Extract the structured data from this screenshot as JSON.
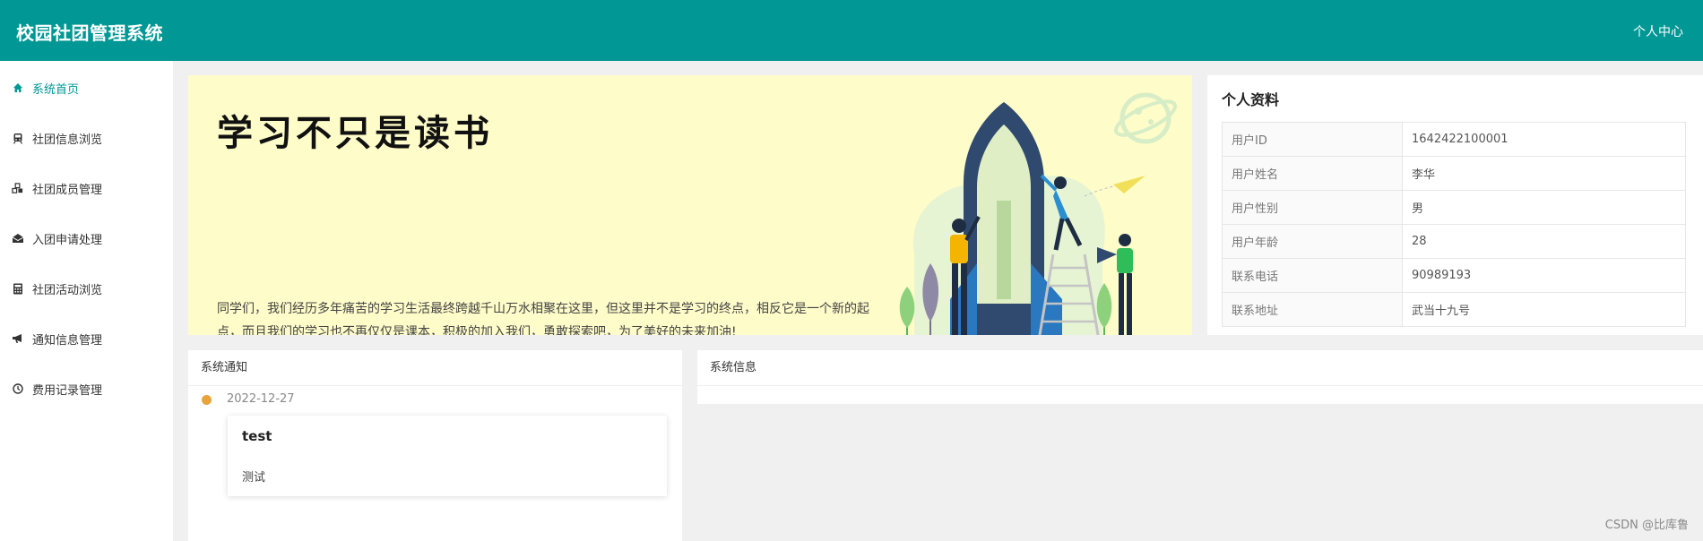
{
  "header": {
    "app_title": "校园社团管理系统",
    "user_center": "个人中心"
  },
  "sidebar": {
    "items": [
      {
        "label": "系统首页",
        "icon": "home-icon",
        "active": true
      },
      {
        "label": "社团信息浏览",
        "icon": "train-icon",
        "active": false
      },
      {
        "label": "社团成员管理",
        "icon": "cubes-icon",
        "active": false
      },
      {
        "label": "入团申请处理",
        "icon": "envelope-open-icon",
        "active": false
      },
      {
        "label": "社团活动浏览",
        "icon": "calculator-icon",
        "active": false
      },
      {
        "label": "通知信息管理",
        "icon": "bullhorn-icon",
        "active": false
      },
      {
        "label": "费用记录管理",
        "icon": "clock-icon",
        "active": false
      }
    ]
  },
  "banner": {
    "headline": "学习不只是读书",
    "description": "同学们，我们经历多年痛苦的学习生活最终跨越千山万水相聚在这里，但这里并不是学习的终点，相反它是一个新的起点，而且我们的学习也不再仅仅是课本，积极的加入我们，勇敢探索吧，为了美好的未来加油!"
  },
  "profile": {
    "title": "个人资料",
    "rows": [
      {
        "key": "用户ID",
        "value": "1642422100001"
      },
      {
        "key": "用户姓名",
        "value": "李华"
      },
      {
        "key": "用户性别",
        "value": "男"
      },
      {
        "key": "用户年龄",
        "value": "28"
      },
      {
        "key": "联系电话",
        "value": "90989193"
      },
      {
        "key": "联系地址",
        "value": "武当十九号"
      }
    ]
  },
  "notice": {
    "title": "系统通知",
    "items": [
      {
        "date": "2022-12-27",
        "title": "test",
        "content": "测试"
      }
    ]
  },
  "sysinfo": {
    "title": "系统信息"
  },
  "watermark": "CSDN @比库鲁",
  "colors": {
    "primary": "#009794",
    "banner_bg": "#fefcc9",
    "dot": "#e8a33d"
  }
}
